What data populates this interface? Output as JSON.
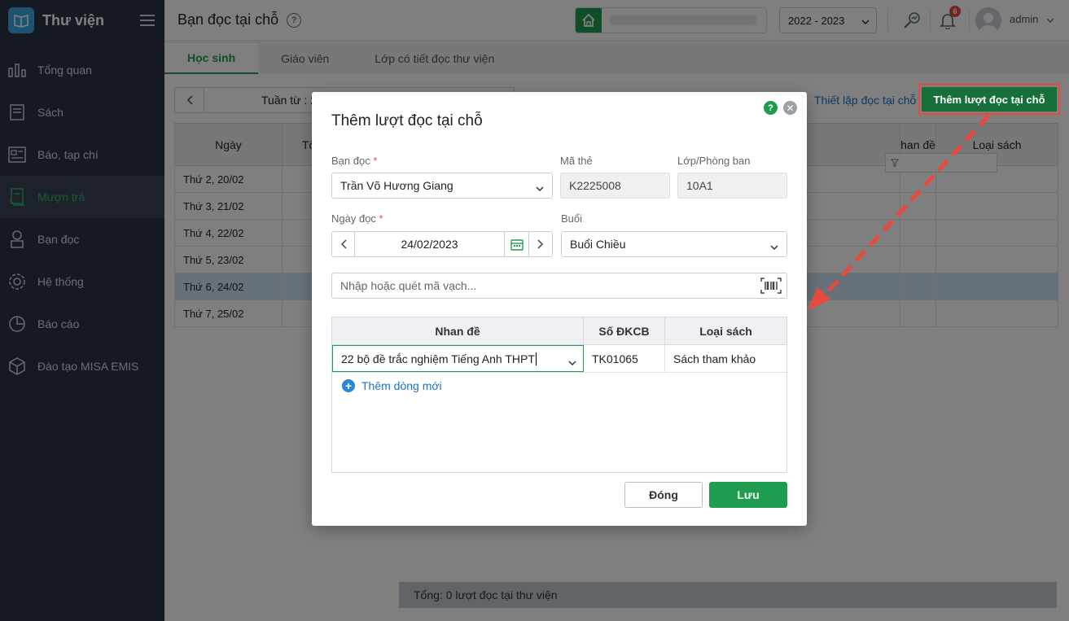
{
  "app": {
    "name": "Thư viện"
  },
  "sidebar": {
    "items": [
      {
        "label": "Tổng quan",
        "icon": "bar-chart-icon"
      },
      {
        "label": "Sách",
        "icon": "book-icon"
      },
      {
        "label": "Báo, tạp chí",
        "icon": "newspaper-icon"
      },
      {
        "label": "Mượn trả",
        "icon": "borrow-return-icon",
        "active": true
      },
      {
        "label": "Bạn đọc",
        "icon": "reader-icon"
      },
      {
        "label": "Hệ thống",
        "icon": "gear-icon"
      },
      {
        "label": "Báo cáo",
        "icon": "pie-chart-icon"
      },
      {
        "label": "Đào tạo MISA EMIS",
        "icon": "cube-icon"
      }
    ]
  },
  "header": {
    "title": "Bạn đọc tại chỗ",
    "school_year": "2022 - 2023",
    "notification_count": "6",
    "user": "admin"
  },
  "tabs": [
    "Học sinh",
    "Giáo viên",
    "Lớp có tiết đọc thư viện"
  ],
  "main": {
    "week_label": "Tuần từ : 2",
    "setup_link": "Thiết lập đọc tại chỗ",
    "add_button": "Thêm lượt đọc tại chỗ",
    "table_headers": {
      "day": "Ngày",
      "col2": "Tổ",
      "title": "han đề",
      "type": "Loại sách"
    },
    "days": [
      "Thứ 2, 20/02",
      "Thứ 3, 21/02",
      "Thứ 4, 22/02",
      "Thứ 5, 23/02",
      "Thứ 6, 24/02",
      "Thứ 7, 25/02"
    ],
    "total": "Tổng: 0 lượt đọc tại thư viện"
  },
  "modal": {
    "title": "Thêm lượt đọc tại chỗ",
    "reader_label": "Bạn đọc",
    "reader_value": "Trần Võ Hương Giang",
    "card_label": "Mã thẻ",
    "card_value": "K2225008",
    "class_label": "Lớp/Phòng ban",
    "class_value": "10A1",
    "date_label": "Ngày đọc",
    "date_value": "24/02/2023",
    "session_label": "Buổi",
    "session_value": "Buổi Chiều",
    "barcode_placeholder": "Nhập hoặc quét mã vạch...",
    "grid_headers": {
      "title": "Nhan đề",
      "code": "Số ĐKCB",
      "type": "Loại sách"
    },
    "rows": [
      {
        "title": "22 bộ đề trắc nghiệm Tiếng Anh THPT",
        "code": "TK01065",
        "type": "Sách tham khảo"
      }
    ],
    "add_row": "Thêm dòng mới",
    "close_button": "Đóng",
    "save_button": "Lưu"
  },
  "colors": {
    "primary": "#1e9c4f",
    "sidebar": "#2b3544",
    "link": "#1a73c9",
    "highlight": "#e84a3d"
  }
}
